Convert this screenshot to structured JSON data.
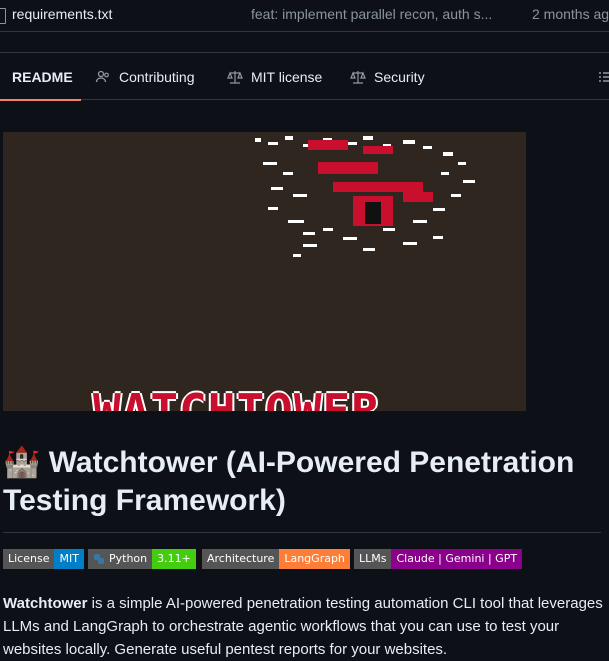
{
  "file_row": {
    "name": "requirements.txt",
    "commit_message": "feat: implement parallel recon, auth s...",
    "time": "2 months ag"
  },
  "tabs": [
    {
      "label": "README",
      "icon": "book-icon",
      "active": true
    },
    {
      "label": "Contributing",
      "icon": "people-icon",
      "active": false
    },
    {
      "label": "MIT license",
      "icon": "law-icon",
      "active": false
    },
    {
      "label": "Security",
      "icon": "law-icon",
      "active": false
    }
  ],
  "hero": {
    "logo_text": "WATCHTOWER"
  },
  "readme": {
    "title_emoji": "🏰",
    "title": "Watchtower (AI-Powered Penetration Testing Framework)",
    "badges": [
      {
        "label": "License",
        "value": "MIT",
        "color": "#007ec6"
      },
      {
        "label": "Python",
        "value": "3.11+",
        "color": "#4c1"
      },
      {
        "label": "Architecture",
        "value": "LangGraph",
        "color": "#fe7d37"
      },
      {
        "label": "LLMs",
        "value": "Claude | Gemini | GPT",
        "color": "#8b008b"
      }
    ],
    "para_bold": "Watchtower",
    "para_text": " is a simple AI-powered penetration testing automation CLI tool that leverages LLMs and LangGraph to orchestrate agentic workflows that you can use to test your websites locally. Generate useful pentest reports for your websites."
  },
  "colors": {
    "accent": "#f78166",
    "bg": "#0d1117",
    "border": "#30363d"
  }
}
